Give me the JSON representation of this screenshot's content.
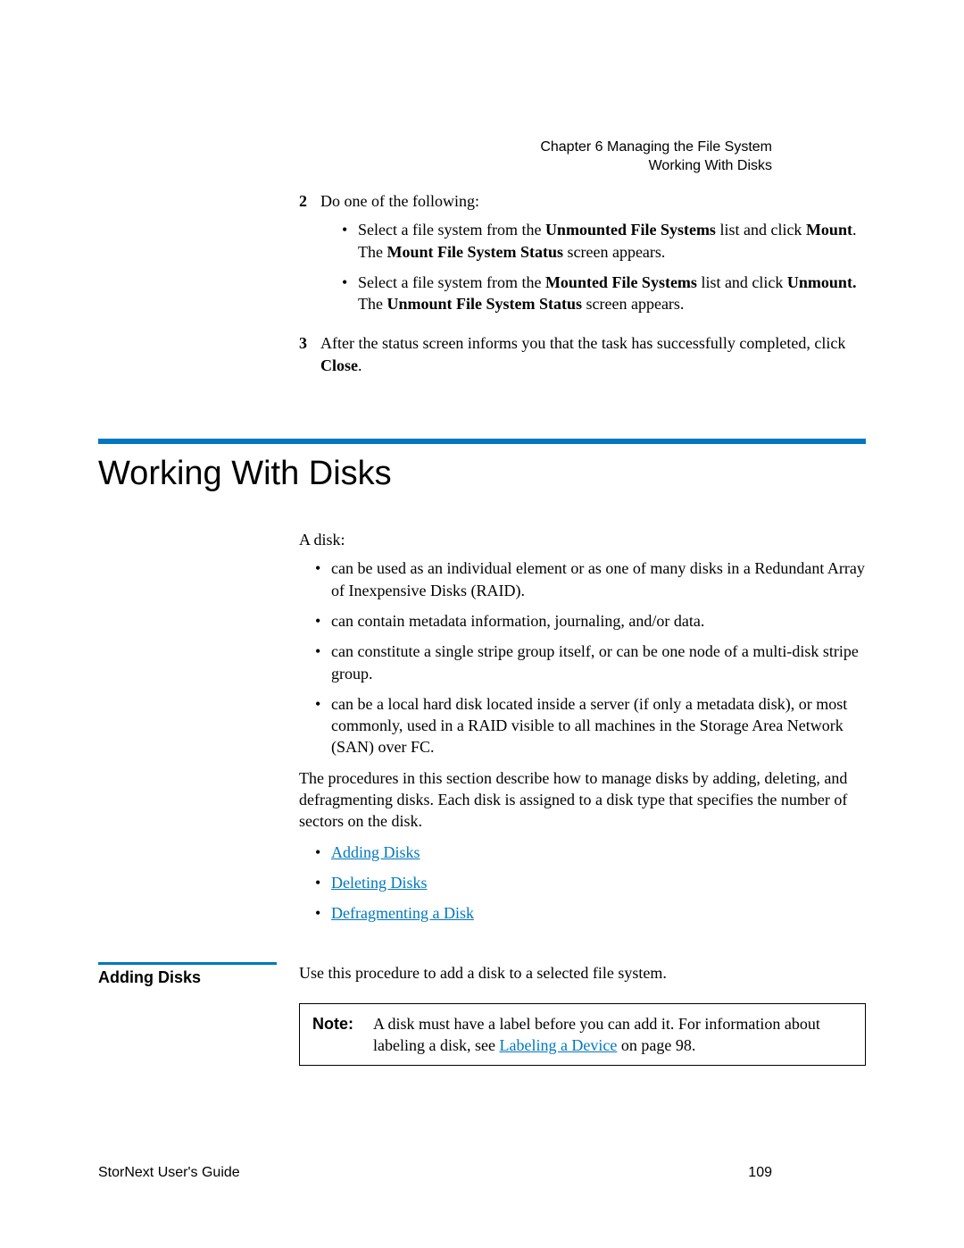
{
  "header": {
    "chapter": "Chapter 6  Managing the File System",
    "section": "Working With Disks"
  },
  "step2": {
    "num": "2",
    "intro": "Do one of the following:",
    "bullet1": {
      "pre": "Select a file system from the ",
      "bold1": "Unmounted File Systems",
      "mid1": " list and click ",
      "bold2": "Mount",
      "mid2": ". The ",
      "bold3": "Mount File System Status",
      "post": " screen appears."
    },
    "bullet2": {
      "pre": "Select a file system from the ",
      "bold1": "Mounted File Systems",
      "mid1": " list and click ",
      "bold2": "Unmount.",
      "mid2": " The ",
      "bold3": "Unmount File System Status",
      "post": " screen appears."
    }
  },
  "step3": {
    "num": "3",
    "pre": "After the status screen informs you that the task has successfully completed, click ",
    "bold": "Close",
    "post": "."
  },
  "section_title": "Working With Disks",
  "disk_intro": "A disk:",
  "disk_bullets": [
    "can be used as an individual element or as one of many disks in a Redundant Array of Inexpensive Disks (RAID).",
    "can contain metadata information, journaling, and/or data.",
    "can constitute a single stripe group itself, or can be one node of a multi-disk stripe group.",
    "can be a local hard disk located inside a server (if only a metadata disk), or most commonly, used in a RAID visible to all machines in the Storage Area Network (SAN) over FC."
  ],
  "procedures_para": "The procedures in this section describe how to manage disks by adding, deleting, and defragmenting disks. Each disk is assigned to a disk type that specifies the number of sectors on the disk.",
  "links": [
    "Adding Disks",
    "Deleting Disks",
    "Defragmenting a Disk"
  ],
  "adding_disks": {
    "heading": "Adding Disks",
    "intro": "Use this procedure to add a disk to a selected file system.",
    "note_label": "Note:",
    "note_pre": "A disk must have a label before you can add it. For information about labeling a disk, see ",
    "note_link": "Labeling a Device",
    "note_post": " on page  98."
  },
  "footer": {
    "left": "StorNext User's Guide",
    "right": "109"
  }
}
